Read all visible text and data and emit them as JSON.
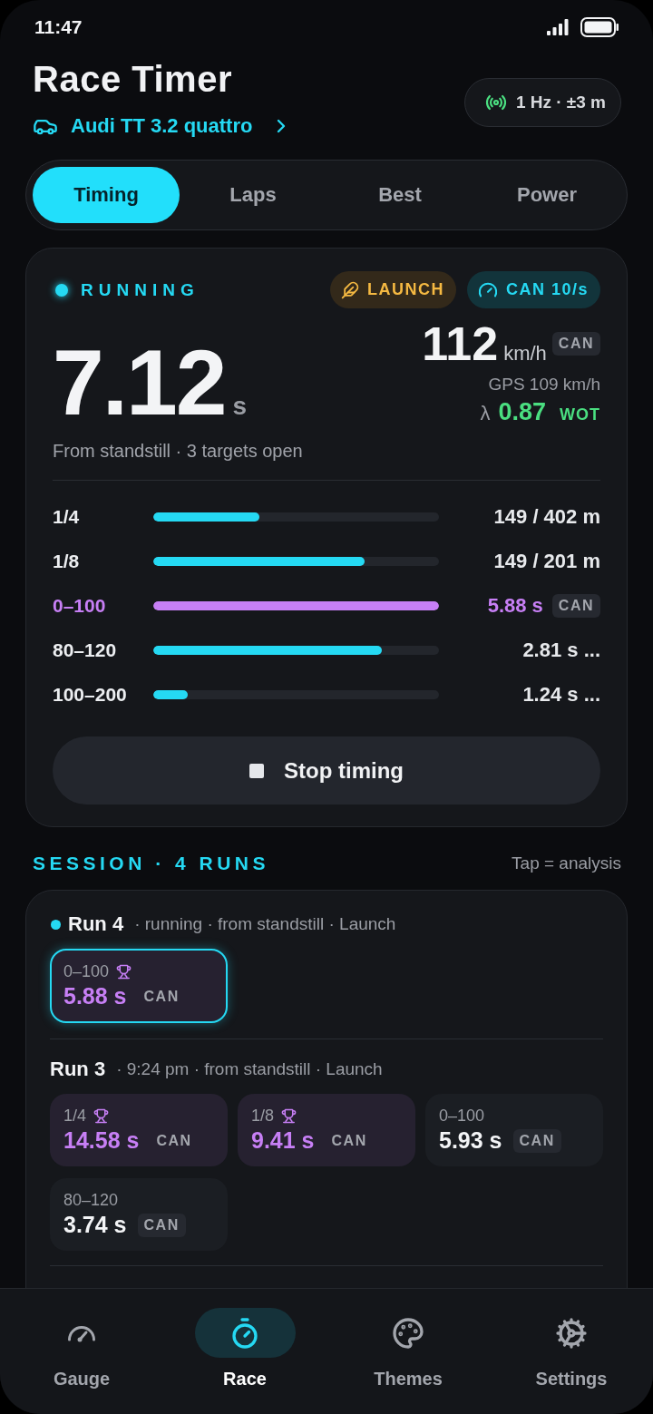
{
  "status_bar": {
    "time": "11:47"
  },
  "header": {
    "title": "Race Timer",
    "vehicle": "Audi TT 3.2 quattro",
    "gps_status": "1 Hz · ±3 m"
  },
  "tabs": [
    {
      "label": "Timing",
      "selected": true
    },
    {
      "label": "Laps",
      "selected": false
    },
    {
      "label": "Best",
      "selected": false
    },
    {
      "label": "Power",
      "selected": false
    }
  ],
  "timer_card": {
    "status": "RUNNING",
    "badges": [
      {
        "kind": "launch",
        "label": "LAUNCH"
      },
      {
        "kind": "can",
        "label": "CAN 10/s"
      }
    ],
    "elapsed": "7.12",
    "elapsed_unit": "s",
    "speed": "112",
    "speed_unit": "km/h",
    "speed_source": "CAN",
    "gps_speed": "GPS 109 km/h",
    "lambda_symbol": "λ",
    "lambda": "0.87",
    "lambda_state": "WOT",
    "summary": "From standstill · 3 targets open",
    "targets": [
      {
        "label": "1/4",
        "level": 0.37,
        "reading": "149 / 402 m",
        "done": false
      },
      {
        "label": "1/8",
        "level": 0.74,
        "reading": "149 / 201 m",
        "done": false
      },
      {
        "label": "0–100",
        "level": 1,
        "reading": "5.88 s",
        "source": "CAN",
        "done": true
      },
      {
        "label": "80–120",
        "level": 0.8,
        "reading": "2.81 s ...",
        "done": false
      },
      {
        "label": "100–200",
        "level": 0.12,
        "reading": "1.24 s ...",
        "done": false
      }
    ],
    "stop_button": "Stop timing"
  },
  "session": {
    "title": "SESSION · 4 RUNS",
    "hint": "Tap = analysis",
    "runs": [
      {
        "name": "Run 4",
        "live": true,
        "details": "· running · from standstill · Launch",
        "results": [
          {
            "label": "0–100",
            "value": "5.88 s",
            "source": "CAN",
            "best": true,
            "active": true
          }
        ]
      },
      {
        "name": "Run 3",
        "live": false,
        "details": "· 9:24 pm · from standstill · Launch",
        "results": [
          {
            "label": "1/4",
            "value": "14.58 s",
            "source": "CAN",
            "best": true,
            "active": false
          },
          {
            "label": "1/8",
            "value": "9.41 s",
            "source": "CAN",
            "best": true,
            "active": false
          },
          {
            "label": "0–100",
            "value": "5.93 s",
            "source": "CAN",
            "best": false,
            "active": false
          },
          {
            "label": "80–120",
            "value": "3.74 s",
            "source": "CAN",
            "best": false,
            "active": false
          }
        ]
      }
    ]
  },
  "bottom_nav": [
    {
      "kind": "gauge",
      "label": "Gauge",
      "selected": false
    },
    {
      "kind": "stopwatch",
      "label": "Race",
      "selected": true
    },
    {
      "kind": "palette",
      "label": "Themes",
      "selected": false
    },
    {
      "kind": "settings",
      "label": "Settings",
      "selected": false
    }
  ]
}
